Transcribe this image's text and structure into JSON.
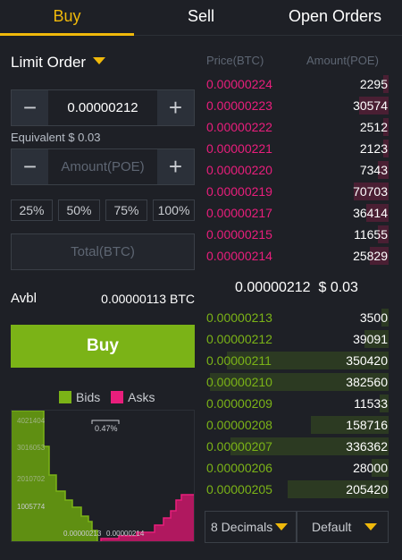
{
  "tabs": [
    {
      "label": "Buy",
      "active": true
    },
    {
      "label": "Sell",
      "active": false
    },
    {
      "label": "Open Orders",
      "active": false
    }
  ],
  "order_form": {
    "order_type": "Limit Order",
    "price_value": "0.00000212",
    "equivalent": "Equivalent $ 0.03",
    "amount_placeholder": "Amount(POE)",
    "percent_buttons": [
      "25%",
      "50%",
      "75%",
      "100%"
    ],
    "total_placeholder": "Total(BTC)",
    "avbl_label": "Avbl",
    "avbl_value": "0.00000113 BTC",
    "buy_label": "Buy",
    "minus_symbol": "−",
    "plus_symbol": "+"
  },
  "depth_chart": {
    "legend": [
      "Bids",
      "Asks"
    ],
    "y_labels": [
      "4021404",
      "3016053",
      "2010702",
      "1005774"
    ],
    "x_labels": [
      "0.00000213",
      "0.00000214"
    ],
    "spread_label": "0.47%",
    "bids_color": "#7bb317",
    "asks_color": "#e91e7c"
  },
  "order_book": {
    "price_header": "Price(BTC)",
    "amount_header": "Amount(POE)",
    "asks": [
      {
        "price": "0.00000224",
        "amount": "2295",
        "fill": 0.03
      },
      {
        "price": "0.00000223",
        "amount": "30574",
        "fill": 0.16
      },
      {
        "price": "0.00000222",
        "amount": "2512",
        "fill": 0.03
      },
      {
        "price": "0.00000221",
        "amount": "2123",
        "fill": 0.03
      },
      {
        "price": "0.00000220",
        "amount": "7343",
        "fill": 0.06
      },
      {
        "price": "0.00000219",
        "amount": "70703",
        "fill": 0.19
      },
      {
        "price": "0.00000217",
        "amount": "36414",
        "fill": 0.12
      },
      {
        "price": "0.00000215",
        "amount": "11655",
        "fill": 0.06
      },
      {
        "price": "0.00000214",
        "amount": "25829",
        "fill": 0.1
      }
    ],
    "last_price": "0.00000212",
    "last_price_usd": "$ 0.03",
    "bids": [
      {
        "price": "0.00000213",
        "amount": "3500",
        "fill": 0.04
      },
      {
        "price": "0.00000212",
        "amount": "39091",
        "fill": 0.13
      },
      {
        "price": "0.00000211",
        "amount": "350420",
        "fill": 0.88
      },
      {
        "price": "0.00000210",
        "amount": "382560",
        "fill": 0.97
      },
      {
        "price": "0.00000209",
        "amount": "11533",
        "fill": 0.05
      },
      {
        "price": "0.00000208",
        "amount": "158716",
        "fill": 0.42
      },
      {
        "price": "0.00000207",
        "amount": "336362",
        "fill": 0.86
      },
      {
        "price": "0.00000206",
        "amount": "28000",
        "fill": 0.09
      },
      {
        "price": "0.00000205",
        "amount": "205420",
        "fill": 0.55
      }
    ],
    "decimals_label": "8 Decimals",
    "default_label": "Default"
  }
}
